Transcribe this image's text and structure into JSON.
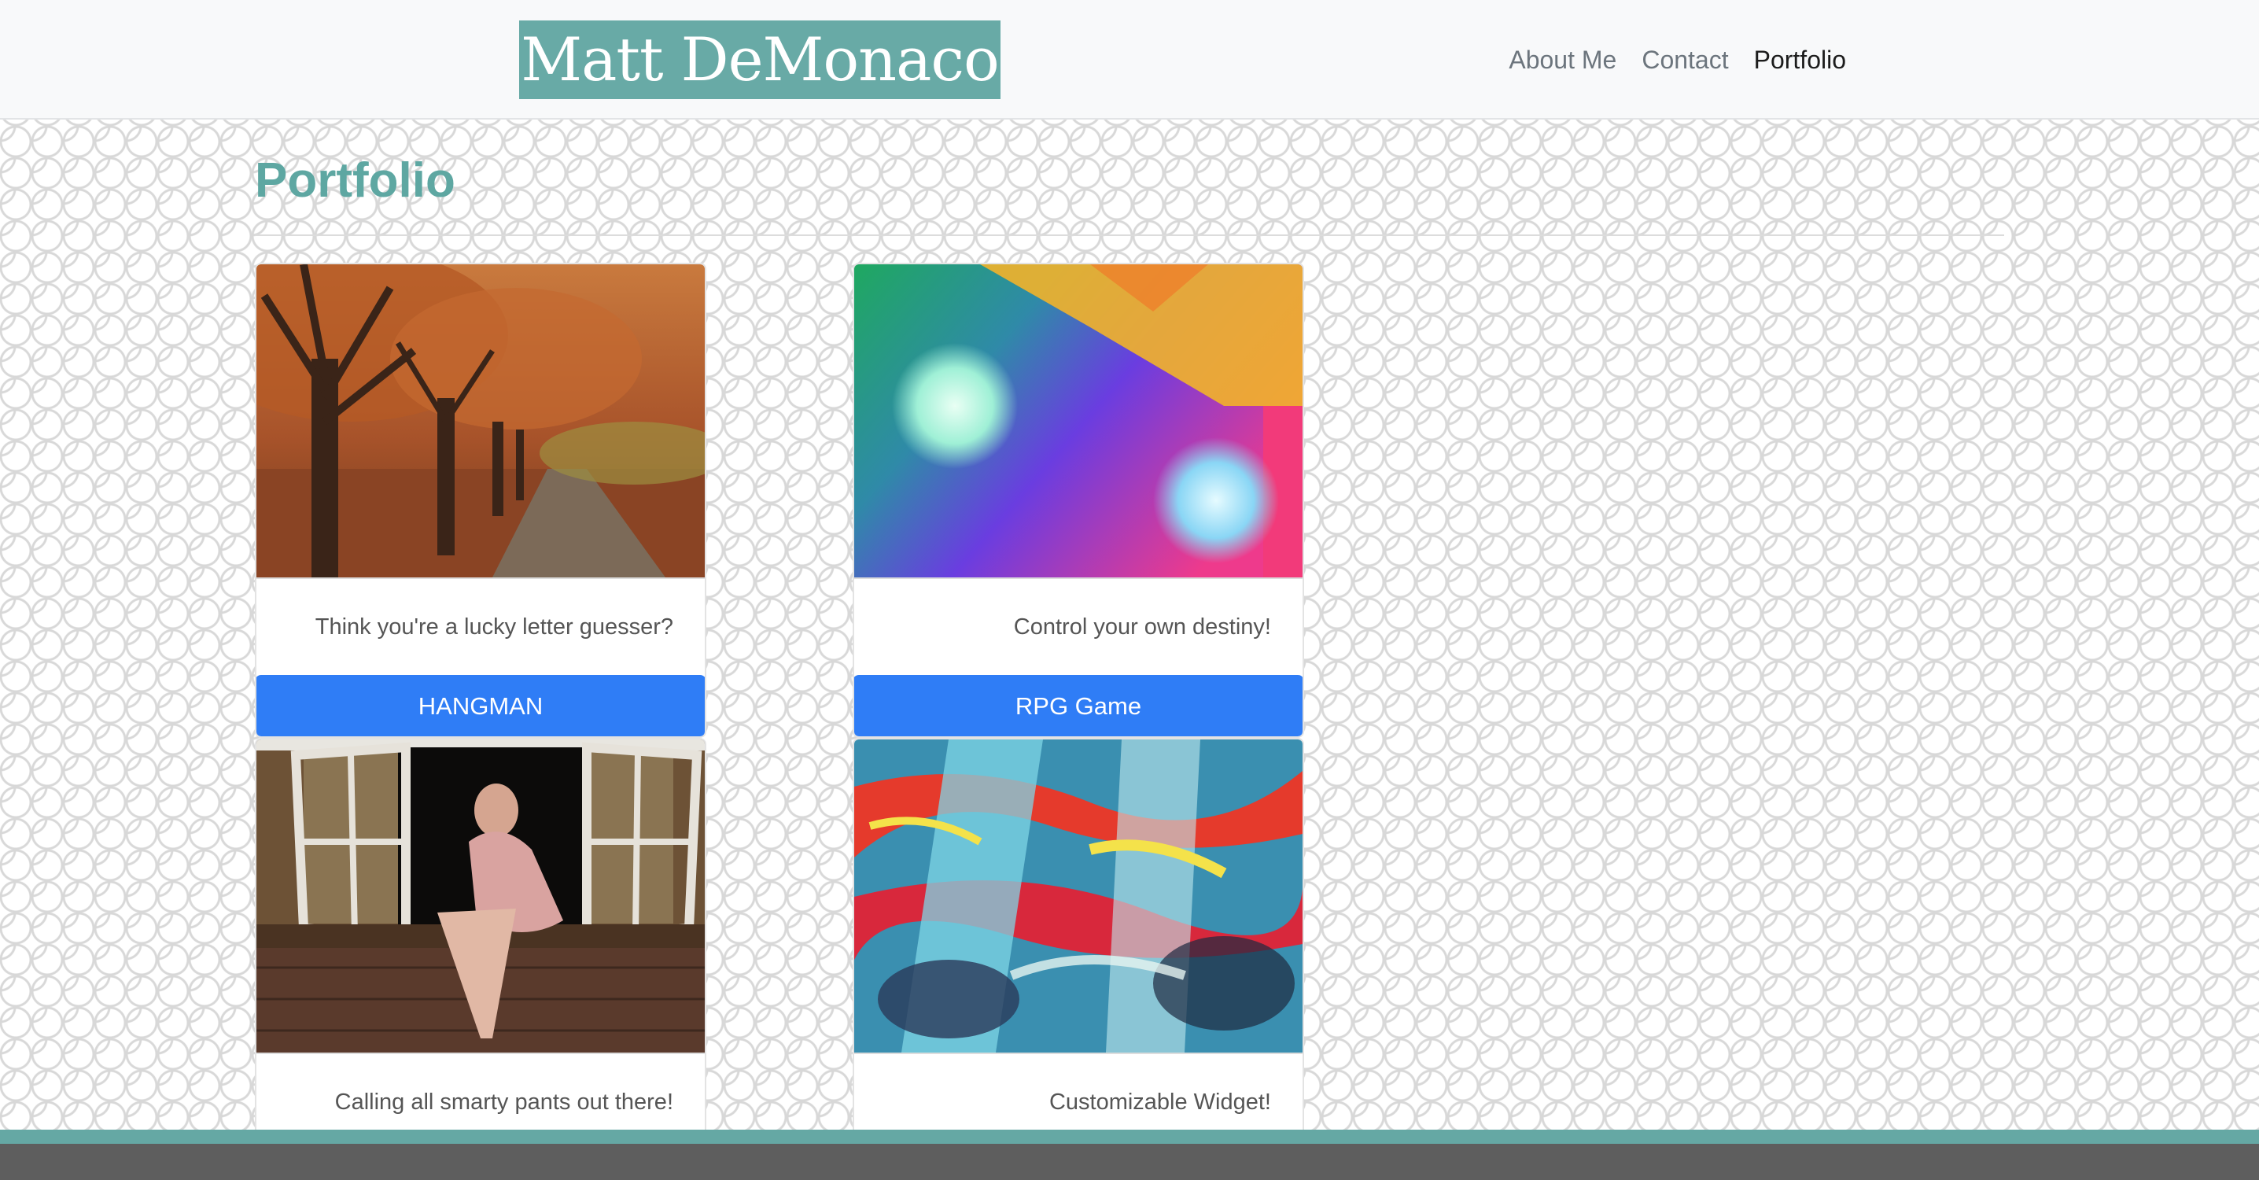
{
  "header": {
    "brand": "Matt DeMonaco",
    "nav": [
      {
        "label": "About Me",
        "active": false
      },
      {
        "label": "Contact",
        "active": false
      },
      {
        "label": "Portfolio",
        "active": true
      }
    ]
  },
  "main": {
    "title": "Portfolio",
    "cards": [
      {
        "image": "autumn-trees-photo",
        "description": "Think you're a lucky letter guesser?",
        "button_label": "HANGMAN"
      },
      {
        "image": "colorful-bokeh-photo",
        "description": "Control your own destiny!",
        "button_label": "RPG Game"
      },
      {
        "image": "woman-in-window-photo",
        "description": "Calling all smarty pants out there!"
      },
      {
        "image": "abstract-paint-photo",
        "description": "Customizable Widget!"
      }
    ]
  },
  "colors": {
    "brand_bg": "#68aaa6",
    "title": "#5ea7a2",
    "button": "#2f7df6",
    "footer_accent": "#65a8a4",
    "footer": "#5e5e5e"
  }
}
